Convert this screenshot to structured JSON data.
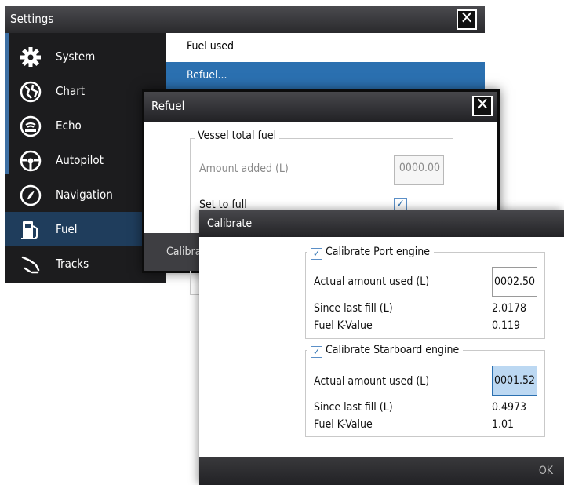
{
  "settings": {
    "title": "Settings",
    "close_glyph": "✕",
    "sidebar": [
      {
        "label": "System",
        "icon": "gear-icon"
      },
      {
        "label": "Chart",
        "icon": "chart-icon"
      },
      {
        "label": "Echo",
        "icon": "echo-icon"
      },
      {
        "label": "Autopilot",
        "icon": "steering-wheel-icon"
      },
      {
        "label": "Navigation",
        "icon": "compass-icon"
      },
      {
        "label": "Fuel",
        "icon": "fuel-pump-icon",
        "selected": true
      },
      {
        "label": "Tracks",
        "icon": "tracks-icon"
      }
    ],
    "content_rows": [
      {
        "label": "Fuel used"
      },
      {
        "label": "Refuel...",
        "selected": true
      }
    ]
  },
  "refuel": {
    "title": "Refuel",
    "close_glyph": "✕",
    "group_title": "Vessel total fuel",
    "amount_label": "Amount added (L)",
    "amount_value": "0000.00",
    "set_full_label": "Set to full",
    "set_full_checked": true,
    "footer_label": "Calibrate"
  },
  "calibrate": {
    "title": "Calibrate",
    "port": {
      "title": "Calibrate Port engine",
      "checked": true,
      "actual_label": "Actual amount used (L)",
      "actual_value": "0002.50",
      "since_label": "Since last fill (L)",
      "since_value": "2.0178",
      "k_label": "Fuel K-Value",
      "k_value": "0.119"
    },
    "starboard": {
      "title": "Calibrate Starboard engine",
      "checked": true,
      "actual_label": "Actual amount used (L)",
      "actual_value": "0001.52",
      "since_label": "Since last fill (L)",
      "since_value": "0.4973",
      "k_label": "Fuel K-Value",
      "k_value": "1.01"
    },
    "ok_label": "OK"
  },
  "colors": {
    "accent": "#2b70b0",
    "selected_sidebar": "#1f3d5c",
    "titlebar": "#2a2a2d"
  }
}
